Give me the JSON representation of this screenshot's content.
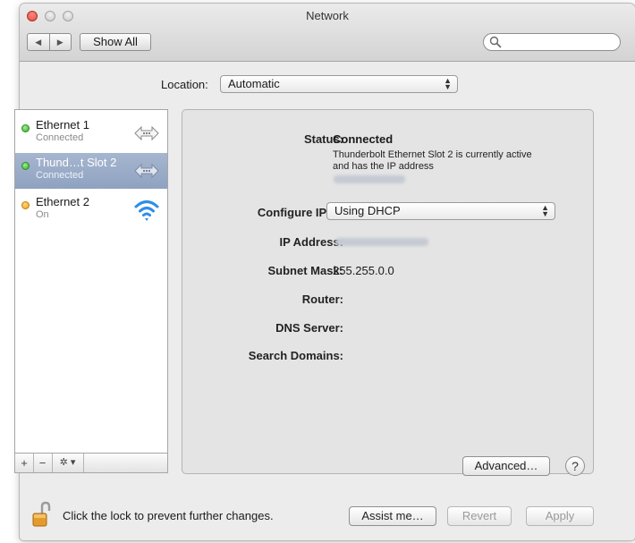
{
  "window": {
    "title": "Network"
  },
  "toolbar": {
    "back_label": "◀",
    "forward_label": "▶",
    "show_all_label": "Show All",
    "search": {
      "value": "",
      "placeholder": ""
    }
  },
  "location": {
    "label": "Location:",
    "value": "Automatic"
  },
  "services": [
    {
      "name": "Ethernet 1",
      "status": "Connected",
      "status_color": "#2fae25",
      "icon": "ethernet-arrows-icon",
      "selected": false
    },
    {
      "name": "Thund…t Slot 2",
      "status": "Connected",
      "status_color": "#2fae25",
      "icon": "ethernet-arrows-icon",
      "selected": true
    },
    {
      "name": "Ethernet 2",
      "status": "On",
      "status_color": "#f0a21e",
      "icon": "wifi-icon",
      "selected": false
    }
  ],
  "sidebar_tools": {
    "add": "+",
    "remove": "−",
    "gear": "✲ ▾"
  },
  "detail": {
    "status_label": "Status:",
    "status_value": "Connected",
    "status_description": "Thunderbolt Ethernet Slot 2 is currently active and has the IP address",
    "configure_label": "Configure IPv4:",
    "configure_value": "Using DHCP",
    "ip_label": "IP Address:",
    "subnet_label": "Subnet Mask:",
    "subnet_value": "255.255.0.0",
    "router_label": "Router:",
    "dns_label": "DNS Server:",
    "search_domains_label": "Search Domains:",
    "advanced_label": "Advanced…",
    "help_label": "?"
  },
  "footer": {
    "lock_text": "Click the lock to prevent further changes.",
    "assist_label": "Assist me…",
    "revert_label": "Revert",
    "apply_label": "Apply"
  },
  "colors": {
    "selection": "#8ea2c1",
    "wifi_blue": "#2f8ee6",
    "lock_orange": "#e59b2b"
  }
}
